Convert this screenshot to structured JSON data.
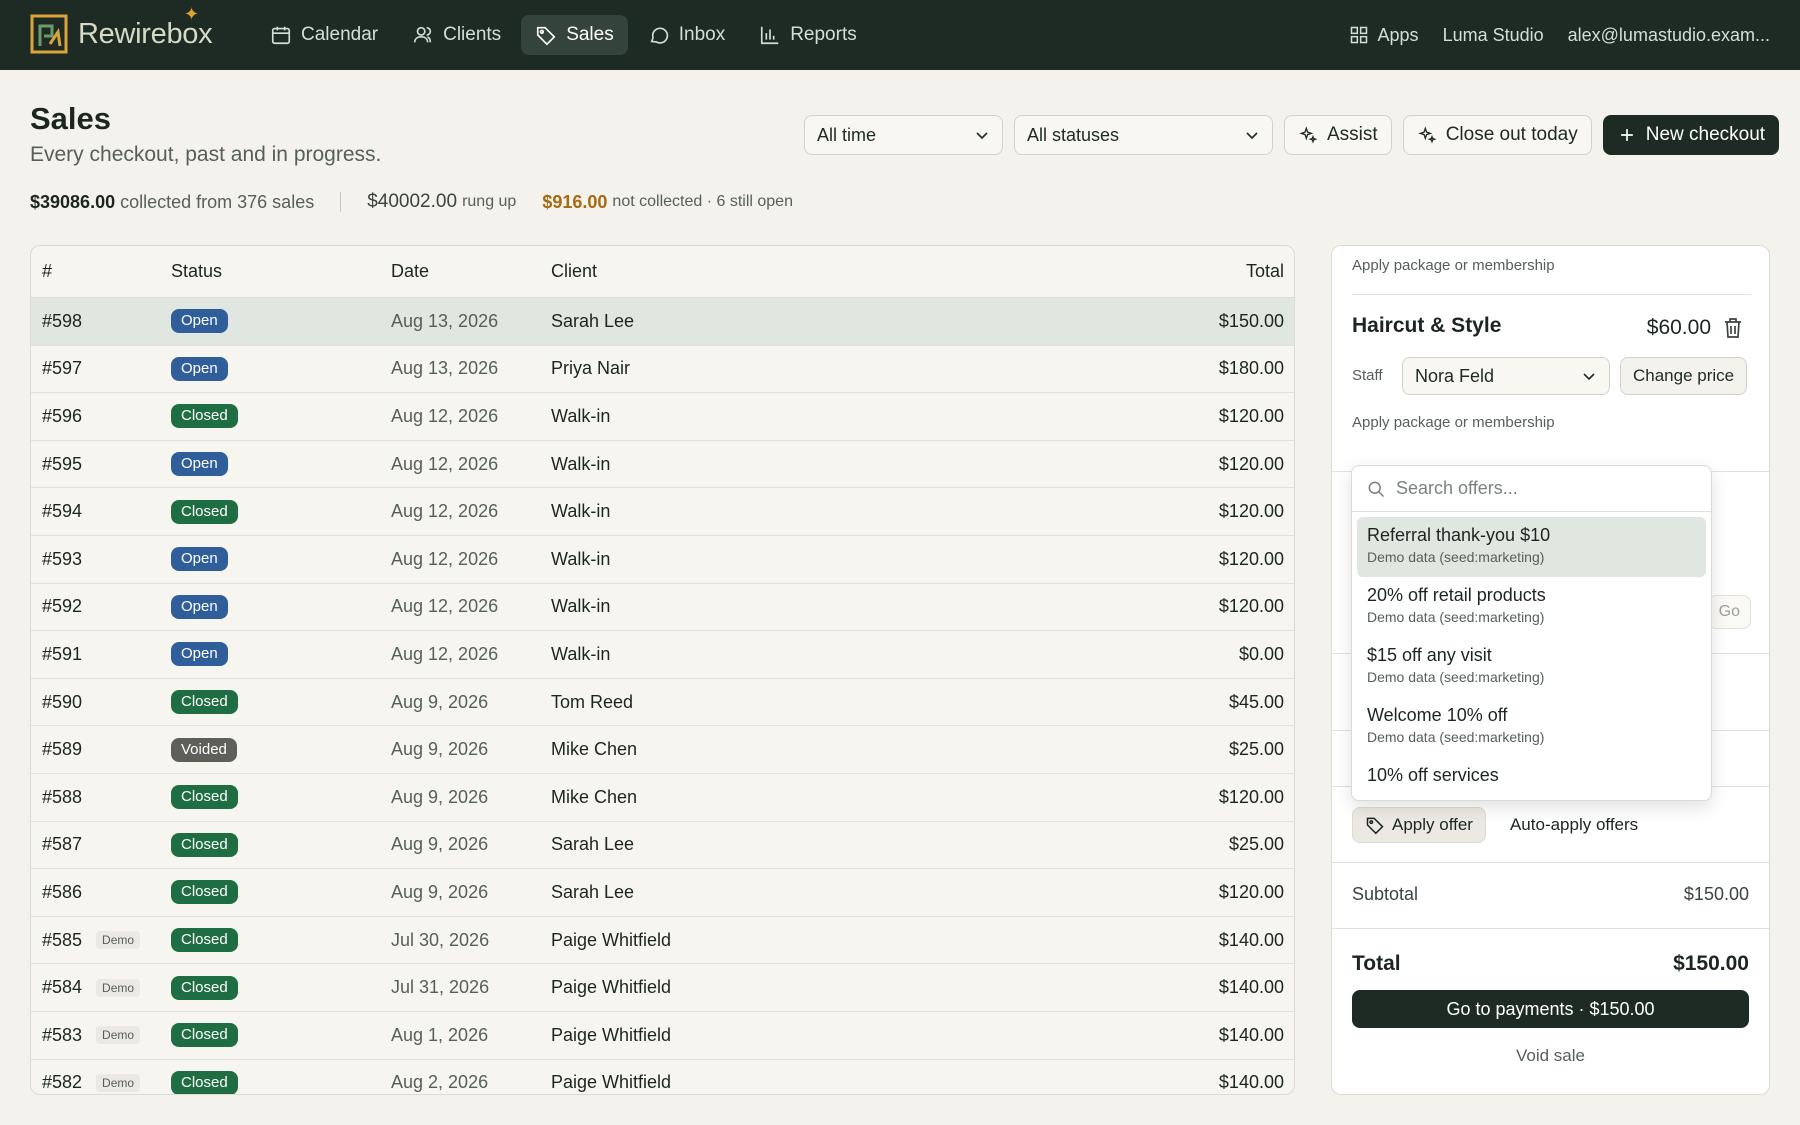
{
  "nav": {
    "brand": "Rewirebox",
    "items": [
      {
        "label": "Calendar",
        "icon": "calendar-icon"
      },
      {
        "label": "Clients",
        "icon": "clients-icon"
      },
      {
        "label": "Sales",
        "icon": "tag-icon",
        "active": true
      },
      {
        "label": "Inbox",
        "icon": "chat-icon"
      },
      {
        "label": "Reports",
        "icon": "chart-icon"
      }
    ],
    "apps_label": "Apps",
    "studio": "Luma Studio",
    "user_email": "alex@lumastudio.exam..."
  },
  "header": {
    "title": "Sales",
    "subtitle": "Every checkout, past and in progress.",
    "stats": {
      "collected_amount": "$39086.00",
      "collected_text": "collected from 376 sales",
      "rung_amount": "$40002.00",
      "rung_text": "rung up",
      "uncollected_amount": "$916.00",
      "uncollected_text": "not collected · 6 still open"
    },
    "filters": {
      "time": "All time",
      "status": "All statuses"
    },
    "buttons": {
      "assist": "Assist",
      "close_out": "Close out today",
      "new_checkout": "New checkout"
    }
  },
  "table": {
    "columns": {
      "num": "#",
      "status": "Status",
      "date": "Date",
      "client": "Client",
      "total": "Total"
    },
    "rows": [
      {
        "num": "#598",
        "demo": "",
        "status": "Open",
        "date": "Aug 13, 2026",
        "client": "Sarah Lee",
        "total": "$150.00"
      },
      {
        "num": "#597",
        "demo": "",
        "status": "Open",
        "date": "Aug 13, 2026",
        "client": "Priya Nair",
        "total": "$180.00"
      },
      {
        "num": "#596",
        "demo": "",
        "status": "Closed",
        "date": "Aug 12, 2026",
        "client": "Walk-in",
        "total": "$120.00"
      },
      {
        "num": "#595",
        "demo": "",
        "status": "Open",
        "date": "Aug 12, 2026",
        "client": "Walk-in",
        "total": "$120.00"
      },
      {
        "num": "#594",
        "demo": "",
        "status": "Closed",
        "date": "Aug 12, 2026",
        "client": "Walk-in",
        "total": "$120.00"
      },
      {
        "num": "#593",
        "demo": "",
        "status": "Open",
        "date": "Aug 12, 2026",
        "client": "Walk-in",
        "total": "$120.00"
      },
      {
        "num": "#592",
        "demo": "",
        "status": "Open",
        "date": "Aug 12, 2026",
        "client": "Walk-in",
        "total": "$120.00"
      },
      {
        "num": "#591",
        "demo": "",
        "status": "Open",
        "date": "Aug 12, 2026",
        "client": "Walk-in",
        "total": "$0.00"
      },
      {
        "num": "#590",
        "demo": "",
        "status": "Closed",
        "date": "Aug 9, 2026",
        "client": "Tom Reed",
        "total": "$45.00"
      },
      {
        "num": "#589",
        "demo": "",
        "status": "Voided",
        "date": "Aug 9, 2026",
        "client": "Mike Chen",
        "total": "$25.00"
      },
      {
        "num": "#588",
        "demo": "",
        "status": "Closed",
        "date": "Aug 9, 2026",
        "client": "Mike Chen",
        "total": "$120.00"
      },
      {
        "num": "#587",
        "demo": "",
        "status": "Closed",
        "date": "Aug 9, 2026",
        "client": "Sarah Lee",
        "total": "$25.00"
      },
      {
        "num": "#586",
        "demo": "",
        "status": "Closed",
        "date": "Aug 9, 2026",
        "client": "Sarah Lee",
        "total": "$120.00"
      },
      {
        "num": "#585",
        "demo": "Demo",
        "status": "Closed",
        "date": "Jul 30, 2026",
        "client": "Paige Whitfield",
        "total": "$140.00"
      },
      {
        "num": "#584",
        "demo": "Demo",
        "status": "Closed",
        "date": "Jul 31, 2026",
        "client": "Paige Whitfield",
        "total": "$140.00"
      },
      {
        "num": "#583",
        "demo": "Demo",
        "status": "Closed",
        "date": "Aug 1, 2026",
        "client": "Paige Whitfield",
        "total": "$140.00"
      },
      {
        "num": "#582",
        "demo": "Demo",
        "status": "Closed",
        "date": "Aug 2, 2026",
        "client": "Paige Whitfield",
        "total": "$140.00"
      }
    ]
  },
  "panel": {
    "apply_package_top": "Apply package or membership",
    "item": {
      "name": "Haircut & Style",
      "price": "$60.00"
    },
    "staff_label": "Staff",
    "staff_value": "Nora Feld",
    "change_price": "Change price",
    "apply_package": "Apply package or membership",
    "go_label": "Go",
    "apply_offer": "Apply offer",
    "auto_apply": "Auto-apply offers",
    "subtotal_label": "Subtotal",
    "subtotal_value": "$150.00",
    "total_label": "Total",
    "total_value": "$150.00",
    "pay_button": "Go to payments · $150.00",
    "void": "Void sale"
  },
  "offers_dropdown": {
    "search_placeholder": "Search offers...",
    "items": [
      {
        "title": "Referral thank-you $10",
        "sub": "Demo data (seed:marketing)"
      },
      {
        "title": "20% off retail products",
        "sub": "Demo data (seed:marketing)"
      },
      {
        "title": "$15 off any visit",
        "sub": "Demo data (seed:marketing)"
      },
      {
        "title": "Welcome 10% off",
        "sub": "Demo data (seed:marketing)"
      },
      {
        "title": "10% off services",
        "sub": ""
      }
    ]
  },
  "colors": {
    "topbar": "#1e2b25",
    "accent_amber": "#a66a12",
    "badge_open": "#2f5e9a",
    "badge_closed": "#1f6e43",
    "badge_voided": "#5e5e5a",
    "selected_row": "#dfe7e0"
  }
}
